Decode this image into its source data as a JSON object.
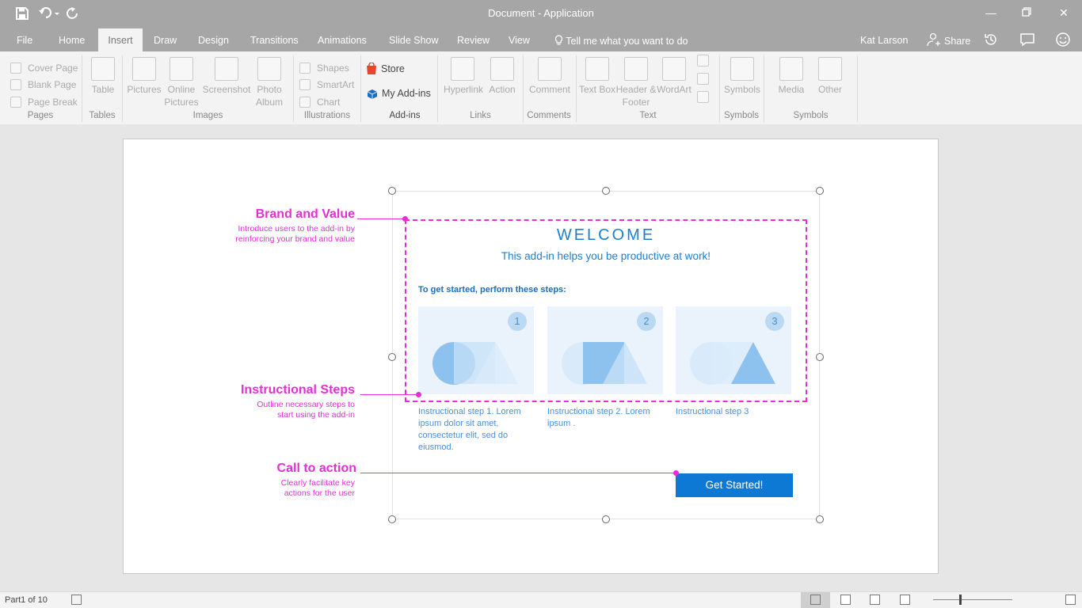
{
  "app": {
    "title": "Document - Application"
  },
  "icons": {
    "save": "save-icon",
    "undo": "undo-icon",
    "redo": "redo-icon",
    "minimize": "minimize-icon",
    "restore": "restore-icon",
    "close": "close-icon",
    "lightbulb": "lightbulb-icon",
    "share": "share-person-icon",
    "history": "history-icon",
    "comments": "comment-icon",
    "feedback": "smiley-icon"
  },
  "menu": {
    "tabs": [
      "File",
      "Home",
      "Insert",
      "Draw",
      "Design",
      "Transitions",
      "Animations",
      "Slide Show",
      "Review",
      "View"
    ],
    "active": "Insert",
    "tell_me": "Tell me what you want to do",
    "user": "Kat Larson",
    "share": "Share"
  },
  "ribbon": {
    "pages": {
      "items": [
        "Cover Page",
        "Blank Page",
        "Page Break"
      ],
      "group": "Pages"
    },
    "tables": {
      "items": [
        "Table"
      ],
      "group": "Tables"
    },
    "images": {
      "items": [
        "Pictures",
        "Online Pictures",
        "Screenshot",
        "Photo Album"
      ],
      "group": "Images"
    },
    "illustrations": {
      "items": [
        "Shapes",
        "SmartArt",
        "Chart"
      ],
      "group": "Illustrations"
    },
    "addins": {
      "store": "Store",
      "my_addins": "My Add-ins",
      "group": "Add-ins"
    },
    "links": {
      "items": [
        "Hyperlink",
        "Action"
      ],
      "group": "Links"
    },
    "comments": {
      "items": [
        "Comment"
      ],
      "group": "Comments"
    },
    "text": {
      "items": [
        "Text Box",
        "Header & Footer",
        "WordArt"
      ],
      "group": "Text"
    },
    "symbols": {
      "items": [
        "Symbols"
      ],
      "group": "Symbols"
    },
    "media": {
      "items": [
        "Media",
        "Other"
      ],
      "group": "Symbols"
    }
  },
  "addin": {
    "welcome": "WELCOME",
    "subtitle": "This add-in helps you be productive at work!",
    "steps_heading": "To get started, perform these steps:",
    "steps": [
      {
        "num": "1",
        "caption": "Instructional step 1. Lorem ipsum dolor sit amet, consectetur elit, sed do eiusmod."
      },
      {
        "num": "2",
        "caption": "Instructional step 2. Lorem ipsum ."
      },
      {
        "num": "3",
        "caption": "Instructional step 3"
      }
    ],
    "cta": "Get Started!"
  },
  "annotations": [
    {
      "title": "Brand and Value",
      "desc": "Introduce users to the add-in by reinforcing your brand and value"
    },
    {
      "title": "Instructional Steps",
      "desc": "Outline necessary steps to start using the add-in"
    },
    {
      "title": "Call to action",
      "desc": "Clearly facilitate key actions for the user"
    }
  ],
  "status": {
    "page": "Part1 of 10"
  },
  "colors": {
    "chrome": "#a6a6a6",
    "ribbon": "#f3f3f3",
    "accent": "#0e78d5",
    "annotation": "#e52ed6"
  }
}
